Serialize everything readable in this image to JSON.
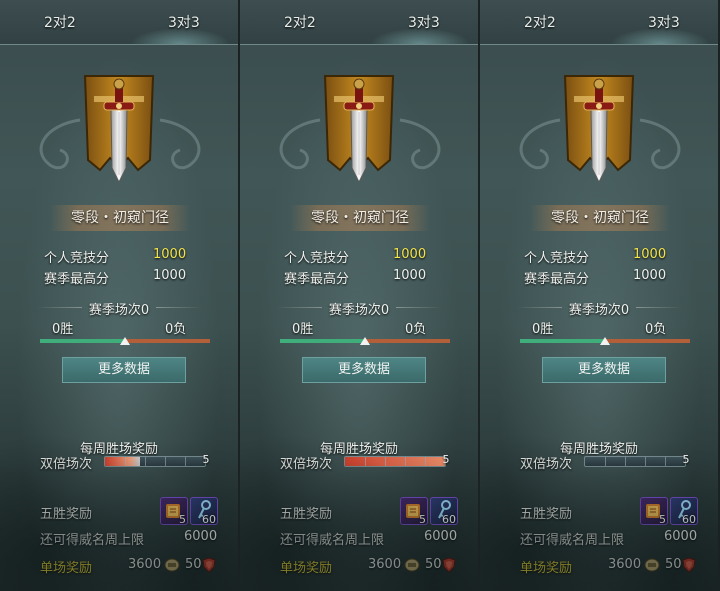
{
  "panels": [
    {
      "tabs": {
        "left": "2对2",
        "right": "3对3"
      },
      "rank_title": "零段・初窥门径",
      "stats": {
        "personal_label": "个人竞技分",
        "personal_value": "1000",
        "best_label": "赛季最高分",
        "best_value": "1000"
      },
      "season": {
        "count_text": "赛季场次0",
        "wins": "0胜",
        "losses": "0负",
        "win_ratio": 0.5
      },
      "more_button": "更多数据",
      "weekly": {
        "title": "每周胜场奖励",
        "double_label": "双倍场次",
        "double_value": "5",
        "fill_fraction": 0.35
      },
      "rewards": {
        "five_win_label": "五胜奖励",
        "item1_count": "5",
        "item2_count": "60",
        "remaining_label": "还可得威名周上限",
        "remaining_value": "6000",
        "single_label": "单场奖励",
        "single_coin": "3600",
        "single_shield": "50"
      }
    },
    {
      "tabs": {
        "left": "2对2",
        "right": "3对3"
      },
      "rank_title": "零段・初窥门径",
      "stats": {
        "personal_label": "个人竞技分",
        "personal_value": "1000",
        "best_label": "赛季最高分",
        "best_value": "1000"
      },
      "season": {
        "count_text": "赛季场次0",
        "wins": "0胜",
        "losses": "0负",
        "win_ratio": 0.5
      },
      "more_button": "更多数据",
      "weekly": {
        "title": "每周胜场奖励",
        "double_label": "双倍场次",
        "double_value": "5",
        "fill_fraction": 1.0
      },
      "rewards": {
        "five_win_label": "五胜奖励",
        "item1_count": "5",
        "item2_count": "60",
        "remaining_label": "还可得威名周上限",
        "remaining_value": "6000",
        "single_label": "单场奖励",
        "single_coin": "3600",
        "single_shield": "50"
      }
    },
    {
      "tabs": {
        "left": "2对2",
        "right": "3对3"
      },
      "rank_title": "零段・初窥门径",
      "stats": {
        "personal_label": "个人竞技分",
        "personal_value": "1000",
        "best_label": "赛季最高分",
        "best_value": "1000"
      },
      "season": {
        "count_text": "赛季场次0",
        "wins": "0胜",
        "losses": "0负",
        "win_ratio": 0.5
      },
      "more_button": "更多数据",
      "weekly": {
        "title": "每周胜场奖励",
        "double_label": "双倍场次",
        "double_value": "5",
        "fill_fraction": 0.0
      },
      "rewards": {
        "five_win_label": "五胜奖励",
        "item1_count": "5",
        "item2_count": "60",
        "remaining_label": "还可得威名周上限",
        "remaining_value": "6000",
        "single_label": "单场奖励",
        "single_coin": "3600",
        "single_shield": "50"
      }
    }
  ],
  "colors": {
    "gold_text": "#f3e44a",
    "win_bar": "#3fae7a",
    "loss_bar": "#b3603a",
    "accent_red": "#e0402a"
  }
}
